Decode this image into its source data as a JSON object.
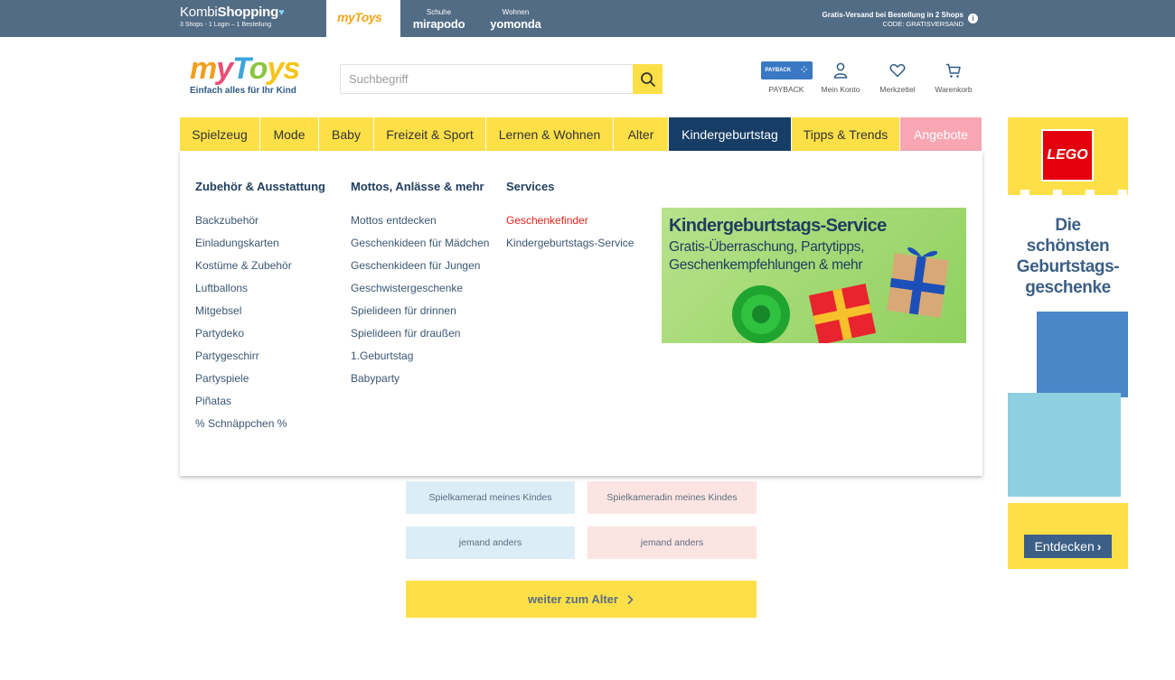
{
  "topbar": {
    "kombi_title_light": "Kombi",
    "kombi_title_bold": "Shopping",
    "kombi_sub": "3 Shops - 1 Login – 1 Bestellung",
    "shops": [
      {
        "id": "mytoys",
        "label": "myToys"
      },
      {
        "id": "mirapodo",
        "small": "Schuhe",
        "label": "mirapodo"
      },
      {
        "id": "yomonda",
        "small": "Wohnen",
        "label": "yomonda"
      }
    ],
    "shipping_line1": "Gratis-Versand bei Bestellung in 2 Shops",
    "shipping_line2": "CODE: GRATISVERSAND"
  },
  "header": {
    "logo_letters": [
      "m",
      "y",
      "T",
      "o",
      "ys"
    ],
    "logo_tagline": "Einfach alles für Ihr Kind",
    "search_placeholder": "Suchbegriff",
    "payback_badge": "PAYBACK",
    "items": [
      {
        "id": "payback",
        "label": "PAYBACK"
      },
      {
        "id": "account",
        "label": "Mein Konto"
      },
      {
        "id": "wishlist",
        "label": "Merkzettel"
      },
      {
        "id": "cart",
        "label": "Warenkorb"
      }
    ]
  },
  "nav": [
    {
      "label": "Spielzeug"
    },
    {
      "label": "Mode"
    },
    {
      "label": "Baby"
    },
    {
      "label": "Freizeit & Sport"
    },
    {
      "label": "Lernen & Wohnen"
    },
    {
      "label": "Alter"
    },
    {
      "label": "Kindergeburtstag"
    },
    {
      "label": "Tipps & Trends"
    },
    {
      "label": "Angebote"
    }
  ],
  "dropdown": {
    "columns": [
      {
        "heading": "Zubehör & Ausstattung",
        "items": [
          "Backzubehör",
          "Einladungskarten",
          "Kostüme & Zubehör",
          "Luftballons",
          "Mitgebsel",
          "Partydeko",
          "Partygeschirr",
          "Partyspiele",
          "Piñatas",
          "% Schnäppchen %"
        ]
      },
      {
        "heading": "Mottos, Anlässe & mehr",
        "items": [
          "Mottos entdecken",
          "Geschenkideen für Mädchen",
          "Geschenkideen für Jungen",
          "Geschwistergeschenke",
          "Spielideen für drinnen",
          "Spielideen für draußen",
          "1.Geburtstag",
          "Babyparty"
        ]
      },
      {
        "heading": "Services",
        "items": [
          "Geschenkefinder",
          "Kindergeburtstags-Service"
        ]
      }
    ],
    "promo_title": "Kindergeburtstags-Service",
    "promo_line1": "Gratis-Überraschung, Partytipps,",
    "promo_line2": "Geschenkempfehlungen & mehr"
  },
  "choices": {
    "row1_left": "Spielkamerad meines Kindes",
    "row1_right": "Spielkameradin meines Kindes",
    "row2_left": "jemand anders",
    "row2_right": "jemand anders",
    "continue_label": "weiter zum Alter"
  },
  "ad": {
    "brand": "LEGO",
    "line1": "Die",
    "line2": "schönsten",
    "line3": "Geburtstags-",
    "line4": "geschenke",
    "button": "Entdecken"
  }
}
